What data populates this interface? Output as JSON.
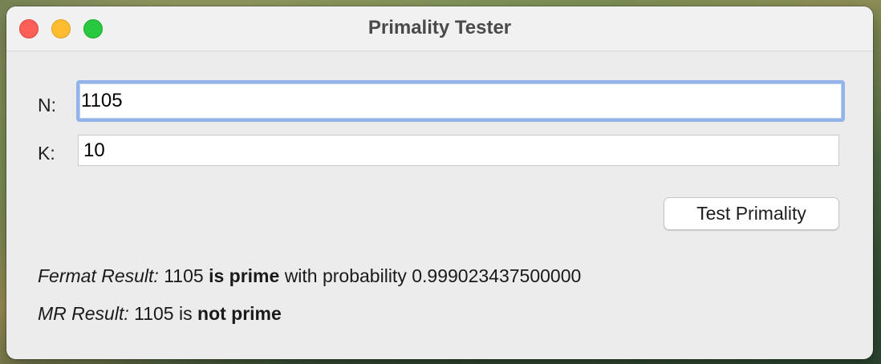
{
  "window": {
    "title": "Primality Tester",
    "controls": [
      "close",
      "minimize",
      "zoom"
    ]
  },
  "form": {
    "n_label": "N:",
    "n_value": "1105",
    "k_label": "K:",
    "k_value": "10",
    "submit_label": "Test Primality"
  },
  "results": {
    "fermat": {
      "label": "Fermat Result:",
      "number": "1105",
      "verdict": "is prime",
      "probability_text": "with probability",
      "probability": "0.999023437500000"
    },
    "mr": {
      "label": "MR Result:",
      "number": "1105",
      "connector": "is",
      "verdict": "not prime"
    }
  },
  "colors": {
    "close": "#fe5f57",
    "minimize": "#febc2e",
    "zoom": "#28c840",
    "focus_ring": "#93b4ea",
    "window_bg": "#ececec"
  }
}
